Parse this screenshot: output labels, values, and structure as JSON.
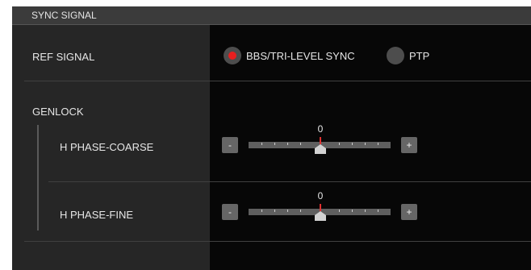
{
  "section": {
    "title": "SYNC SIGNAL"
  },
  "ref_signal": {
    "label": "REF SIGNAL",
    "options": [
      {
        "label": "BBS/TRI-LEVEL SYNC",
        "selected": true
      },
      {
        "label": "PTP",
        "selected": false
      }
    ]
  },
  "genlock": {
    "label": "GENLOCK",
    "h_phase_coarse": {
      "label": "H PHASE-COARSE",
      "value": "0",
      "minus": "-",
      "plus": "+"
    },
    "h_phase_fine": {
      "label": "H PHASE-FINE",
      "value": "0",
      "minus": "-",
      "plus": "+"
    }
  },
  "colors": {
    "selected_radio": "#e81f1f",
    "center_mark": "#e03030"
  }
}
